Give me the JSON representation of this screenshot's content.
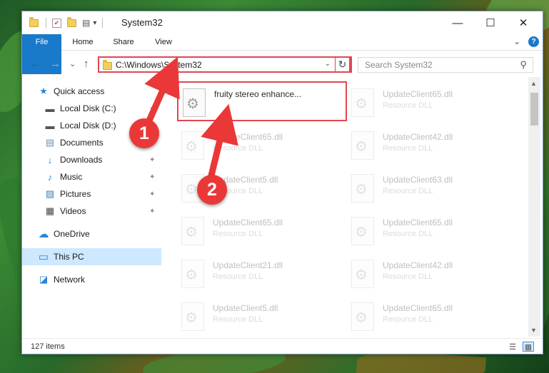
{
  "window": {
    "title": "System32",
    "minimize_glyph": "—",
    "maximize_glyph": "☐",
    "close_glyph": "✕"
  },
  "quick_access_toolbar": {
    "dropdown_glyph": "▾",
    "icons": [
      "folder-icon",
      "properties-icon",
      "new-folder-icon",
      "customize-icon"
    ]
  },
  "ribbon": {
    "tabs": [
      {
        "label": "File",
        "active": true
      },
      {
        "label": "Home"
      },
      {
        "label": "Share"
      },
      {
        "label": "View"
      }
    ],
    "collapse_glyph": "⌄",
    "help_glyph": "?"
  },
  "navigation": {
    "back_glyph": "←",
    "forward_glyph": "→",
    "recent_glyph": "⌄",
    "up_glyph": "↑",
    "address": "C:\\Windows\\System32",
    "address_dropdown_glyph": "⌄",
    "refresh_glyph": "↻",
    "search_placeholder": "Search System32",
    "search_glyph": "⚲"
  },
  "sidebar": {
    "items": [
      {
        "label": "Quick access",
        "icon": "star-icon",
        "glyph": "★",
        "color": "#2d84d6",
        "pinned": false
      },
      {
        "label": "Local Disk (C:)",
        "icon": "drive-icon",
        "glyph": "▬",
        "color": "#555555",
        "pinned": true
      },
      {
        "label": "Local Disk (D:)",
        "icon": "drive-icon",
        "glyph": "▬",
        "color": "#555555",
        "pinned": true
      },
      {
        "label": "Documents",
        "icon": "document-icon",
        "glyph": "▤",
        "color": "#6f8fb0",
        "pinned": true
      },
      {
        "label": "Downloads",
        "icon": "download-icon",
        "glyph": "↓",
        "color": "#2d84d6",
        "pinned": true
      },
      {
        "label": "Music",
        "icon": "music-icon",
        "glyph": "♪",
        "color": "#2d84d6",
        "pinned": true
      },
      {
        "label": "Pictures",
        "icon": "picture-icon",
        "glyph": "▨",
        "color": "#4b7fb8",
        "pinned": true
      },
      {
        "label": "Videos",
        "icon": "video-icon",
        "glyph": "▦",
        "color": "#444444",
        "pinned": true
      },
      {
        "label": "OneDrive",
        "icon": "cloud-icon",
        "glyph": "☁",
        "color": "#2d84d6",
        "pinned": false
      },
      {
        "label": "This PC",
        "icon": "computer-icon",
        "glyph": "▭",
        "color": "#2d84d6",
        "pinned": false,
        "selected": true
      },
      {
        "label": "Network",
        "icon": "network-icon",
        "glyph": "◪",
        "color": "#2d84d6",
        "pinned": false
      }
    ],
    "pin_glyph": "✦"
  },
  "files": [
    {
      "name": "fruity stereo enhance...",
      "type": "",
      "highlighted": true
    },
    {
      "name": "UpdateClient65.dll",
      "type": "Resource DLL"
    },
    {
      "name": "UpdateClient65.dll",
      "type": "Resource DLL"
    },
    {
      "name": "UpdateClient42.dll",
      "type": "Resource DLL"
    },
    {
      "name": "UpdateClient5.dll",
      "type": "Resource DLL"
    },
    {
      "name": "UpdateClient63.dll",
      "type": "Resource DLL"
    },
    {
      "name": "UpdateClient65.dll",
      "type": "Resource DLL"
    },
    {
      "name": "UpdateClient65.dll",
      "type": "Resource DLL"
    },
    {
      "name": "UpdateClient21.dll",
      "type": "Resource DLL"
    },
    {
      "name": "UpdateClient42.dll",
      "type": "Resource DLL"
    },
    {
      "name": "UpdateClient5.dll",
      "type": "Resource DLL"
    },
    {
      "name": "UpdateClient65.dll",
      "type": "Resource DLL"
    }
  ],
  "scrollbar": {
    "up_glyph": "▲",
    "down_glyph": "▼"
  },
  "status": {
    "item_count": "127 items",
    "details_view_glyph": "☰",
    "tiles_view_glyph": "▦"
  },
  "annotations": [
    {
      "number": "1"
    },
    {
      "number": "2"
    }
  ],
  "colors": {
    "accent": "#1979ca",
    "highlight_border": "#e0474f",
    "selection": "#cde8ff",
    "badge": "#ea3838"
  }
}
